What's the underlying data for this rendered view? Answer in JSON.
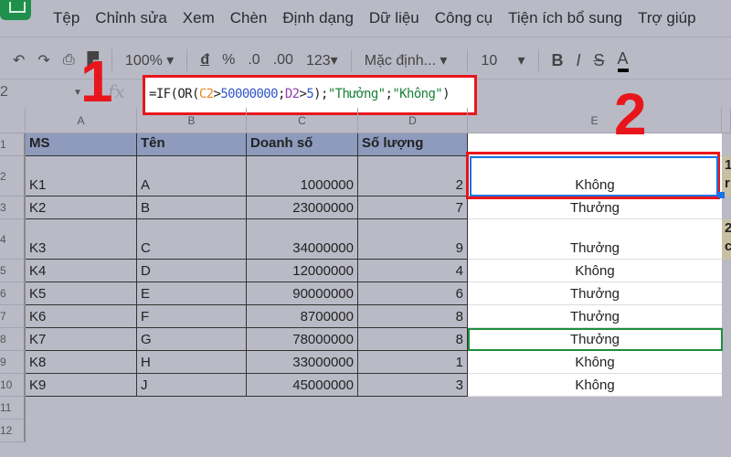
{
  "menu": [
    "Tệp",
    "Chỉnh sửa",
    "Xem",
    "Chèn",
    "Định dạng",
    "Dữ liệu",
    "Công cụ",
    "Tiện ích bổ sung",
    "Trợ giúp"
  ],
  "toolbar": {
    "zoom": "100%",
    "currency": "đ",
    "percent": "%",
    "dec_less": ".0",
    "dec_more": ".00",
    "format": "123",
    "font": "Mặc định...",
    "size": "10",
    "bold": "B",
    "italic": "I",
    "strike": "S",
    "color": "A"
  },
  "name_box": "2",
  "fx": "fx",
  "formula": {
    "p1": "=IF(OR(",
    "ref1": "C2",
    ">": ">",
    "num": "50000000",
    "sep1": ";",
    "ref2": "D2",
    "p2": ">",
    "n2": "5",
    "p3": ");",
    "s1": "\"Thưởng\"",
    "sep2": ";",
    "s2": "\"Không\"",
    "p4": ")"
  },
  "annotations": {
    "one": "1",
    "two": "2"
  },
  "columns": [
    "A",
    "B",
    "C",
    "D",
    "E"
  ],
  "rows": [
    "1",
    "2",
    "3",
    "4",
    "5",
    "6",
    "7",
    "8",
    "9",
    "10",
    "11",
    "12"
  ],
  "header": [
    "MS",
    "Tên",
    "Doanh số",
    "Số lượng"
  ],
  "data": [
    [
      "K1",
      "A",
      "1000000",
      "2",
      "Không"
    ],
    [
      "K2",
      "B",
      "23000000",
      "7",
      "Thưởng"
    ],
    [
      "K3",
      "C",
      "34000000",
      "9",
      "Thưởng"
    ],
    [
      "K4",
      "D",
      "12000000",
      "4",
      "Không"
    ],
    [
      "K5",
      "E",
      "90000000",
      "6",
      "Thưởng"
    ],
    [
      "K6",
      "F",
      "8700000",
      "8",
      "Thưởng"
    ],
    [
      "K7",
      "G",
      "78000000",
      "8",
      "Thưởng"
    ],
    [
      "K8",
      "H",
      "33000000",
      "1",
      "Không"
    ],
    [
      "K9",
      "J",
      "45000000",
      "3",
      "Không"
    ]
  ],
  "side_fragments": [
    "1",
    "r",
    "2",
    "c"
  ]
}
